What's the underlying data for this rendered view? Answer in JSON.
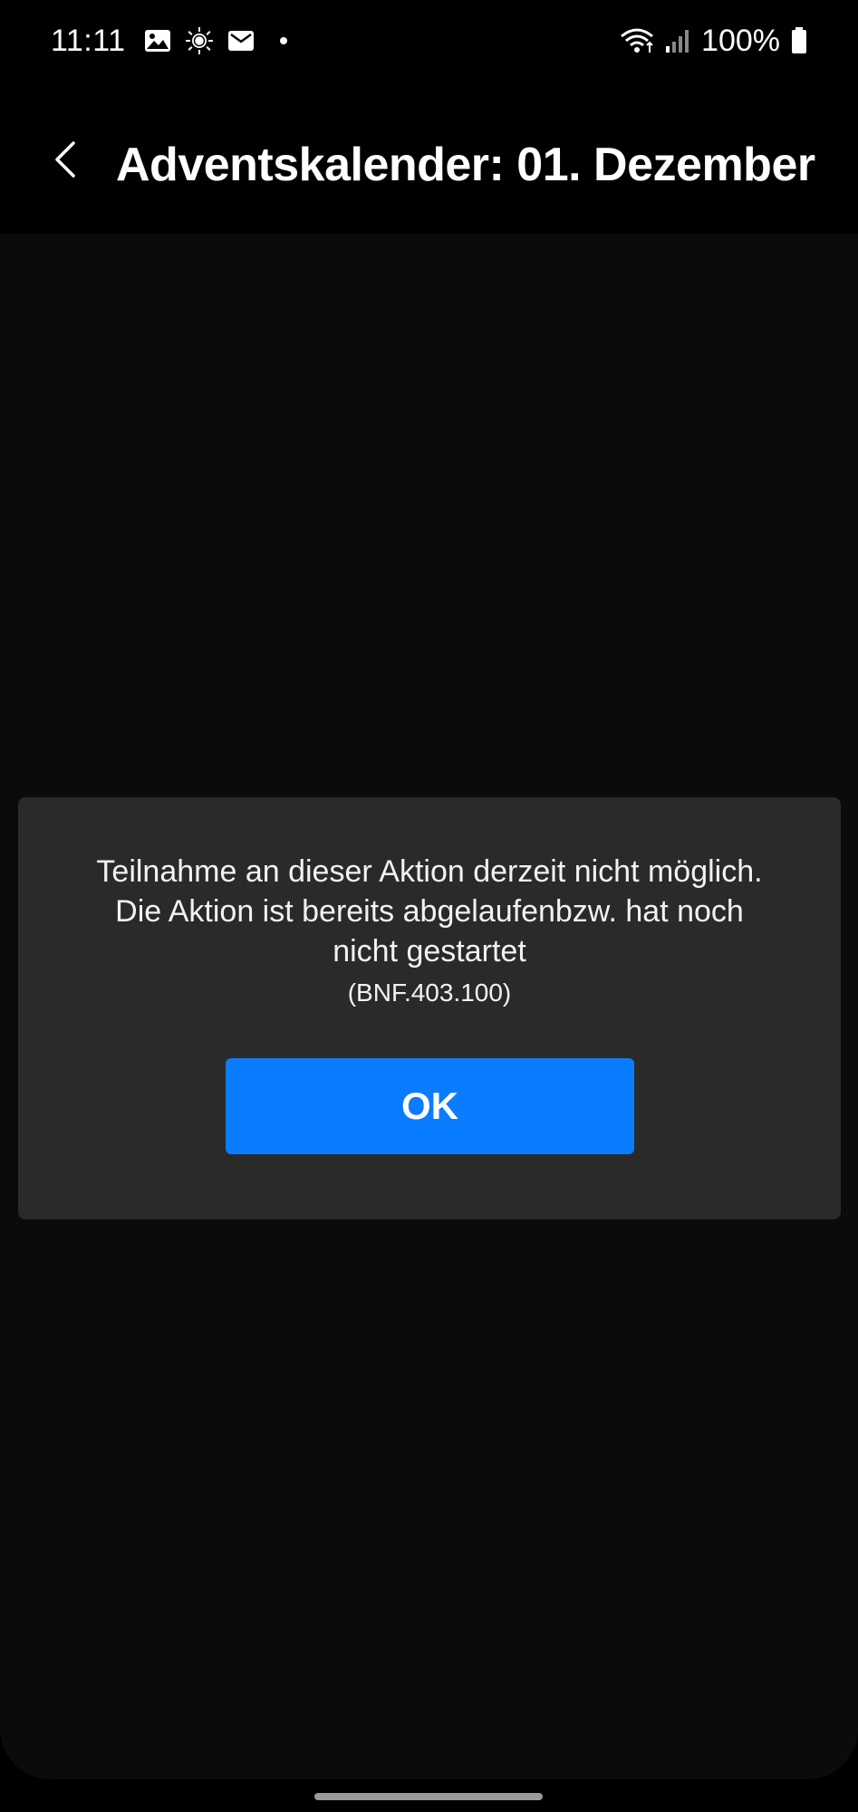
{
  "status_bar": {
    "time": "11:11",
    "battery": "100%",
    "icons": [
      "image-icon",
      "brightness-icon",
      "mail-icon",
      "notification-dot",
      "wifi-icon",
      "signal-icon",
      "battery-icon"
    ]
  },
  "app_bar": {
    "title": "Adventskalender: 01. Dezember",
    "back_icon": "chevron-left-icon"
  },
  "dialog": {
    "message_line1": "Teilnahme an dieser Aktion derzeit nicht möglich.",
    "message_line2": "Die Aktion ist bereits abgelaufenbzw. hat noch",
    "message_line3": "nicht gestartet",
    "code": "(BNF.403.100)",
    "ok_label": "OK"
  },
  "colors": {
    "background": "#000000",
    "content": "#0b0b0b",
    "dialog": "#2a2a2a",
    "accent": "#0a7cff"
  }
}
